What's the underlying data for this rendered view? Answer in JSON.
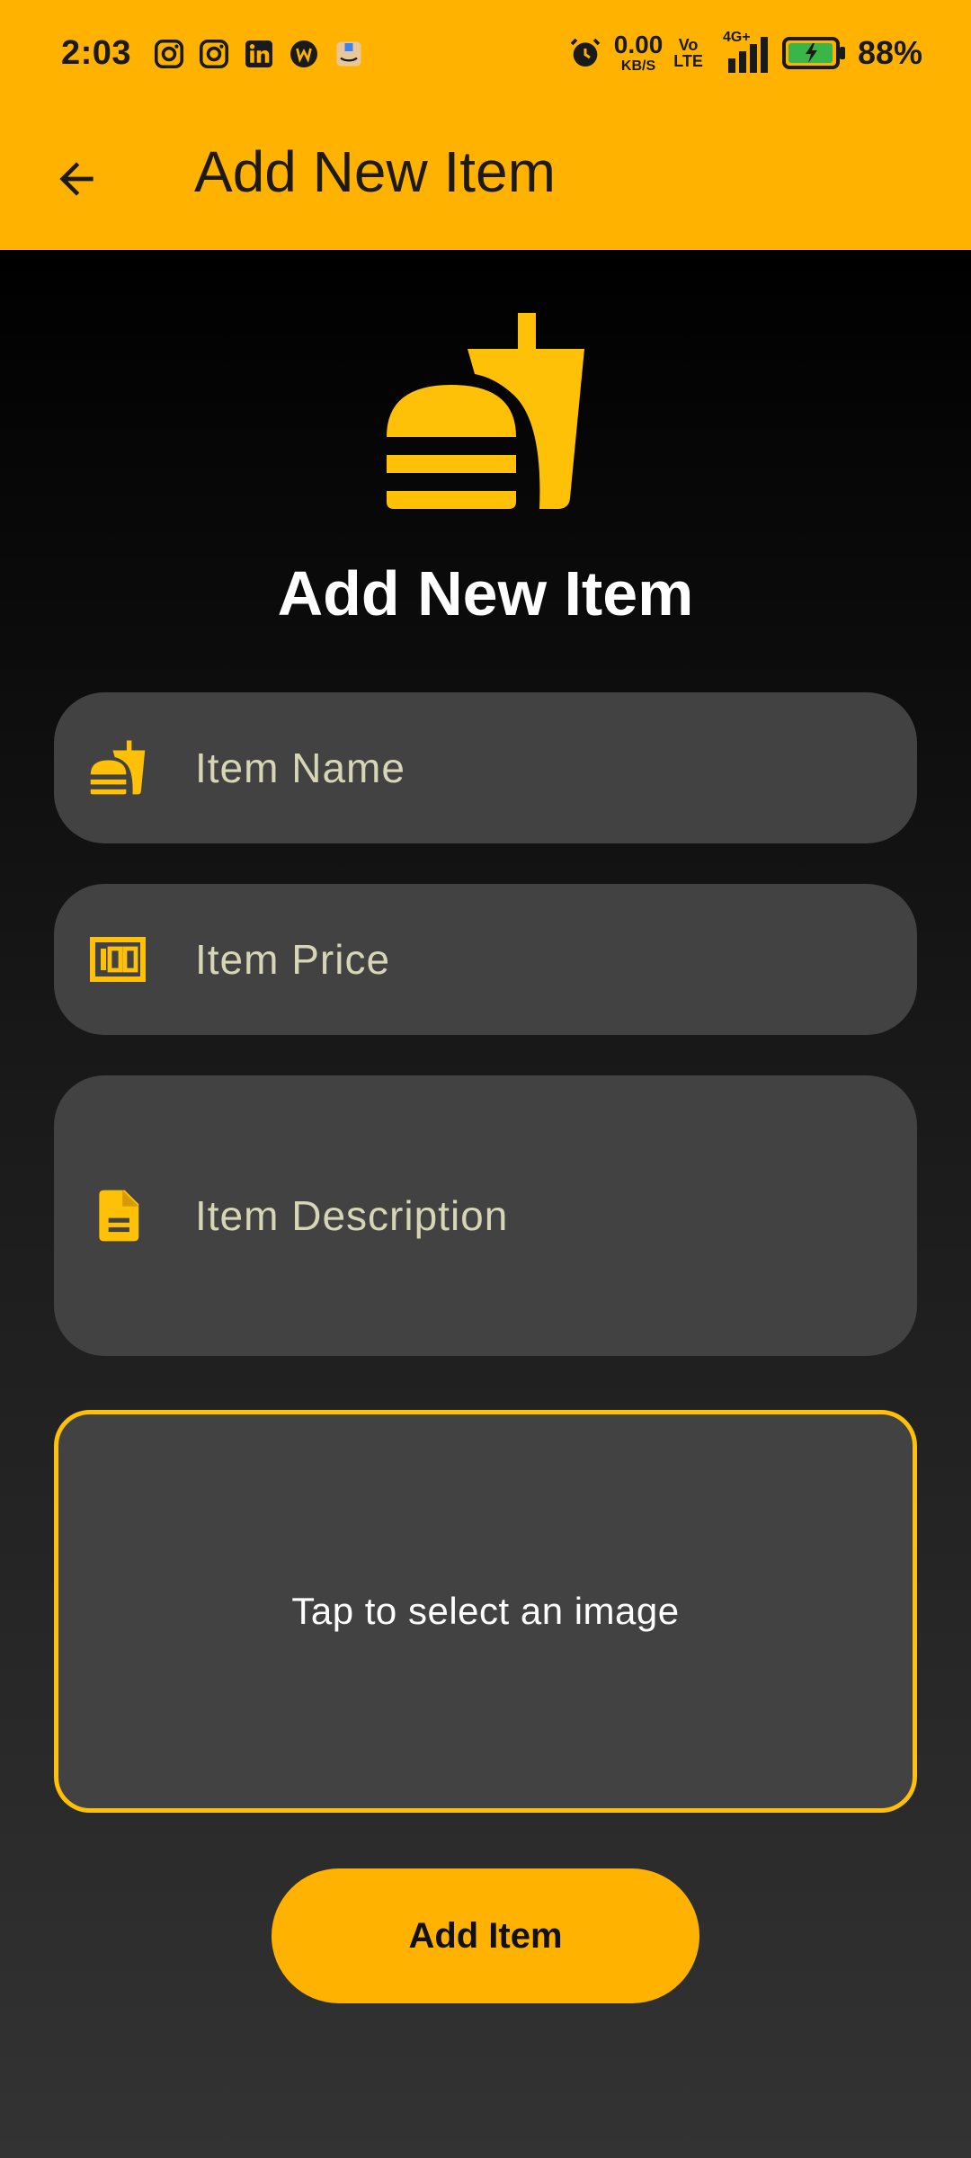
{
  "status_bar": {
    "time": "2:03",
    "notification_icons": [
      "instagram-icon",
      "instagram-icon",
      "linkedin-icon",
      "app-icon",
      "amazon-icon"
    ],
    "net_speed_value": "0.00",
    "net_speed_unit": "KB/S",
    "volte_top": "Vo",
    "volte_bottom": "LTE",
    "network": "4G+",
    "battery_percent": "88%"
  },
  "app_bar": {
    "title": "Add New Item",
    "back_icon": "arrow-back-icon"
  },
  "form": {
    "heading": "Add New Item",
    "hero_icon": "fastfood-icon",
    "fields": [
      {
        "placeholder": "Item Name",
        "icon": "fastfood-icon"
      },
      {
        "placeholder": "Item Price",
        "icon": "money-icon"
      },
      {
        "placeholder": "Item Description",
        "icon": "description-icon"
      }
    ],
    "image_picker_label": "Tap to select an image",
    "submit_label": "Add Item"
  },
  "colors": {
    "accent": "#FFB300",
    "icon_yellow": "#FFC107",
    "field_bg": "#424242",
    "placeholder_text": "#D6D6B6"
  }
}
